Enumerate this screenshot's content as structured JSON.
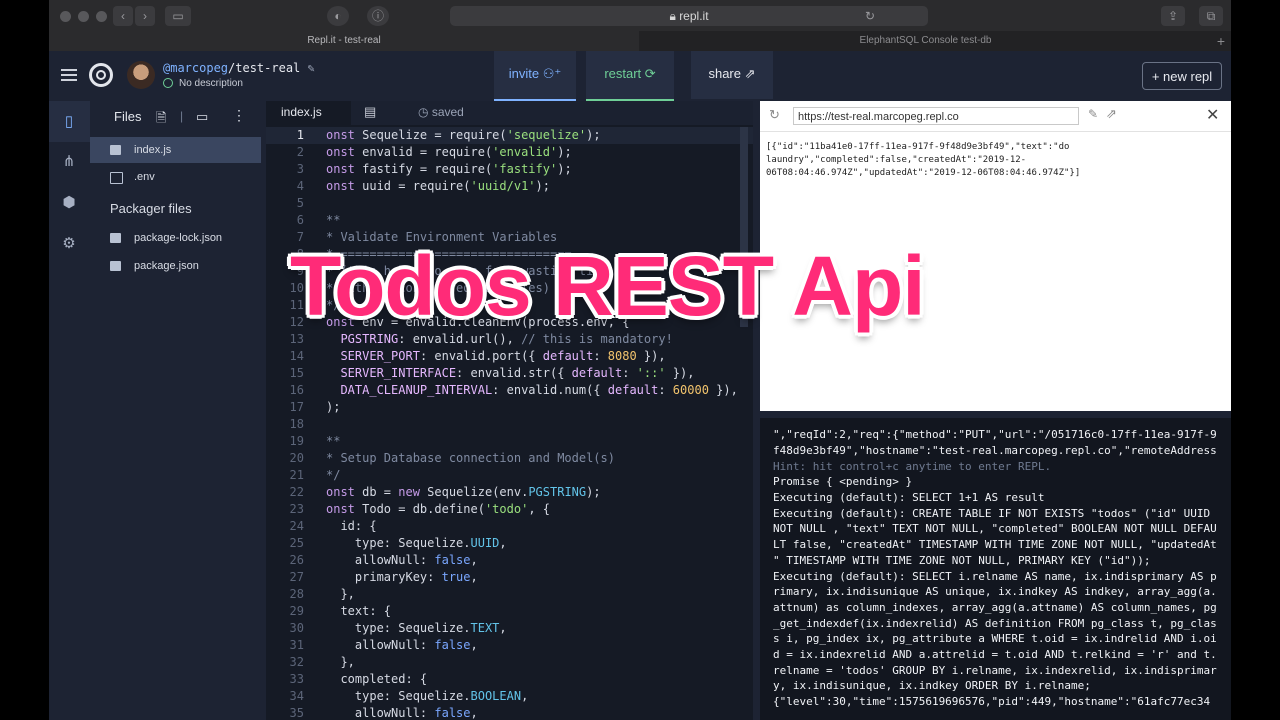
{
  "browser": {
    "url": "repl.it",
    "tabs": [
      "Repl.it - test-real",
      "ElephantSQL Console test-db"
    ]
  },
  "header": {
    "username": "@marcopeg",
    "repl_name": "/test-real",
    "description": "No description",
    "invite_label": "invite",
    "restart_label": "restart",
    "share_label": "share",
    "new_repl_label": "+ new repl"
  },
  "files": {
    "title": "Files",
    "items": [
      "index.js",
      ".env"
    ],
    "packager_title": "Packager files",
    "packager_items": [
      "package-lock.json",
      "package.json"
    ]
  },
  "editor": {
    "tab": "index.js",
    "status": "saved"
  },
  "preview": {
    "url": "https://test-real.marcopeg.repl.co",
    "body_lines": [
      "[{\"id\":\"11ba41e0-17ff-11ea-917f-9f48d9e3bf49\",\"text\":\"do",
      "laundry\",\"completed\":false,\"createdAt\":\"2019-12-",
      "06T08:04:46.974Z\",\"updatedAt\":\"2019-12-06T08:04:46.974Z\"}]"
    ]
  },
  "console": {
    "lines": [
      "\",\"reqId\":2,\"req\":{\"method\":\"PUT\",\"url\":\"/051716c0-17ff-11ea-917f-9",
      "f48d9e3bf49\",\"hostname\":\"test-real.marcopeg.repl.co\",\"remoteAddress",
      "Hint: hit control+c anytime to enter REPL.",
      "Promise { <pending> }",
      "Executing (default): SELECT 1+1 AS result",
      "Executing (default): CREATE TABLE IF NOT EXISTS \"todos\" (\"id\" UUID",
      "NOT NULL , \"text\" TEXT NOT NULL, \"completed\" BOOLEAN NOT NULL DEFAU",
      "LT false, \"createdAt\" TIMESTAMP WITH TIME ZONE NOT NULL, \"updatedAt",
      "\" TIMESTAMP WITH TIME ZONE NOT NULL, PRIMARY KEY (\"id\"));",
      "Executing (default): SELECT i.relname AS name, ix.indisprimary AS p",
      "rimary, ix.indisunique AS unique, ix.indkey AS indkey, array_agg(a.",
      "attnum) as column_indexes, array_agg(a.attname) AS column_names, pg",
      "_get_indexdef(ix.indexrelid) AS definition FROM pg_class t, pg_clas",
      "s i, pg_index ix, pg_attribute a WHERE t.oid = ix.indrelid AND i.oi",
      "d = ix.indexrelid AND a.attrelid = t.oid AND t.relkind = 'r' and t.",
      "relname = 'todos' GROUP BY i.relname, ix.indexrelid, ix.indisprimar",
      "y, ix.indisunique, ix.indkey ORDER BY i.relname;",
      "{\"level\":30,\"time\":1575619696576,\"pid\":449,\"hostname\":\"61afc77ec34"
    ]
  },
  "overlay_title": "Todos REST Api",
  "colors": {
    "accent_green": "#6fcf97",
    "overlay_pink": "#ff2b78"
  }
}
